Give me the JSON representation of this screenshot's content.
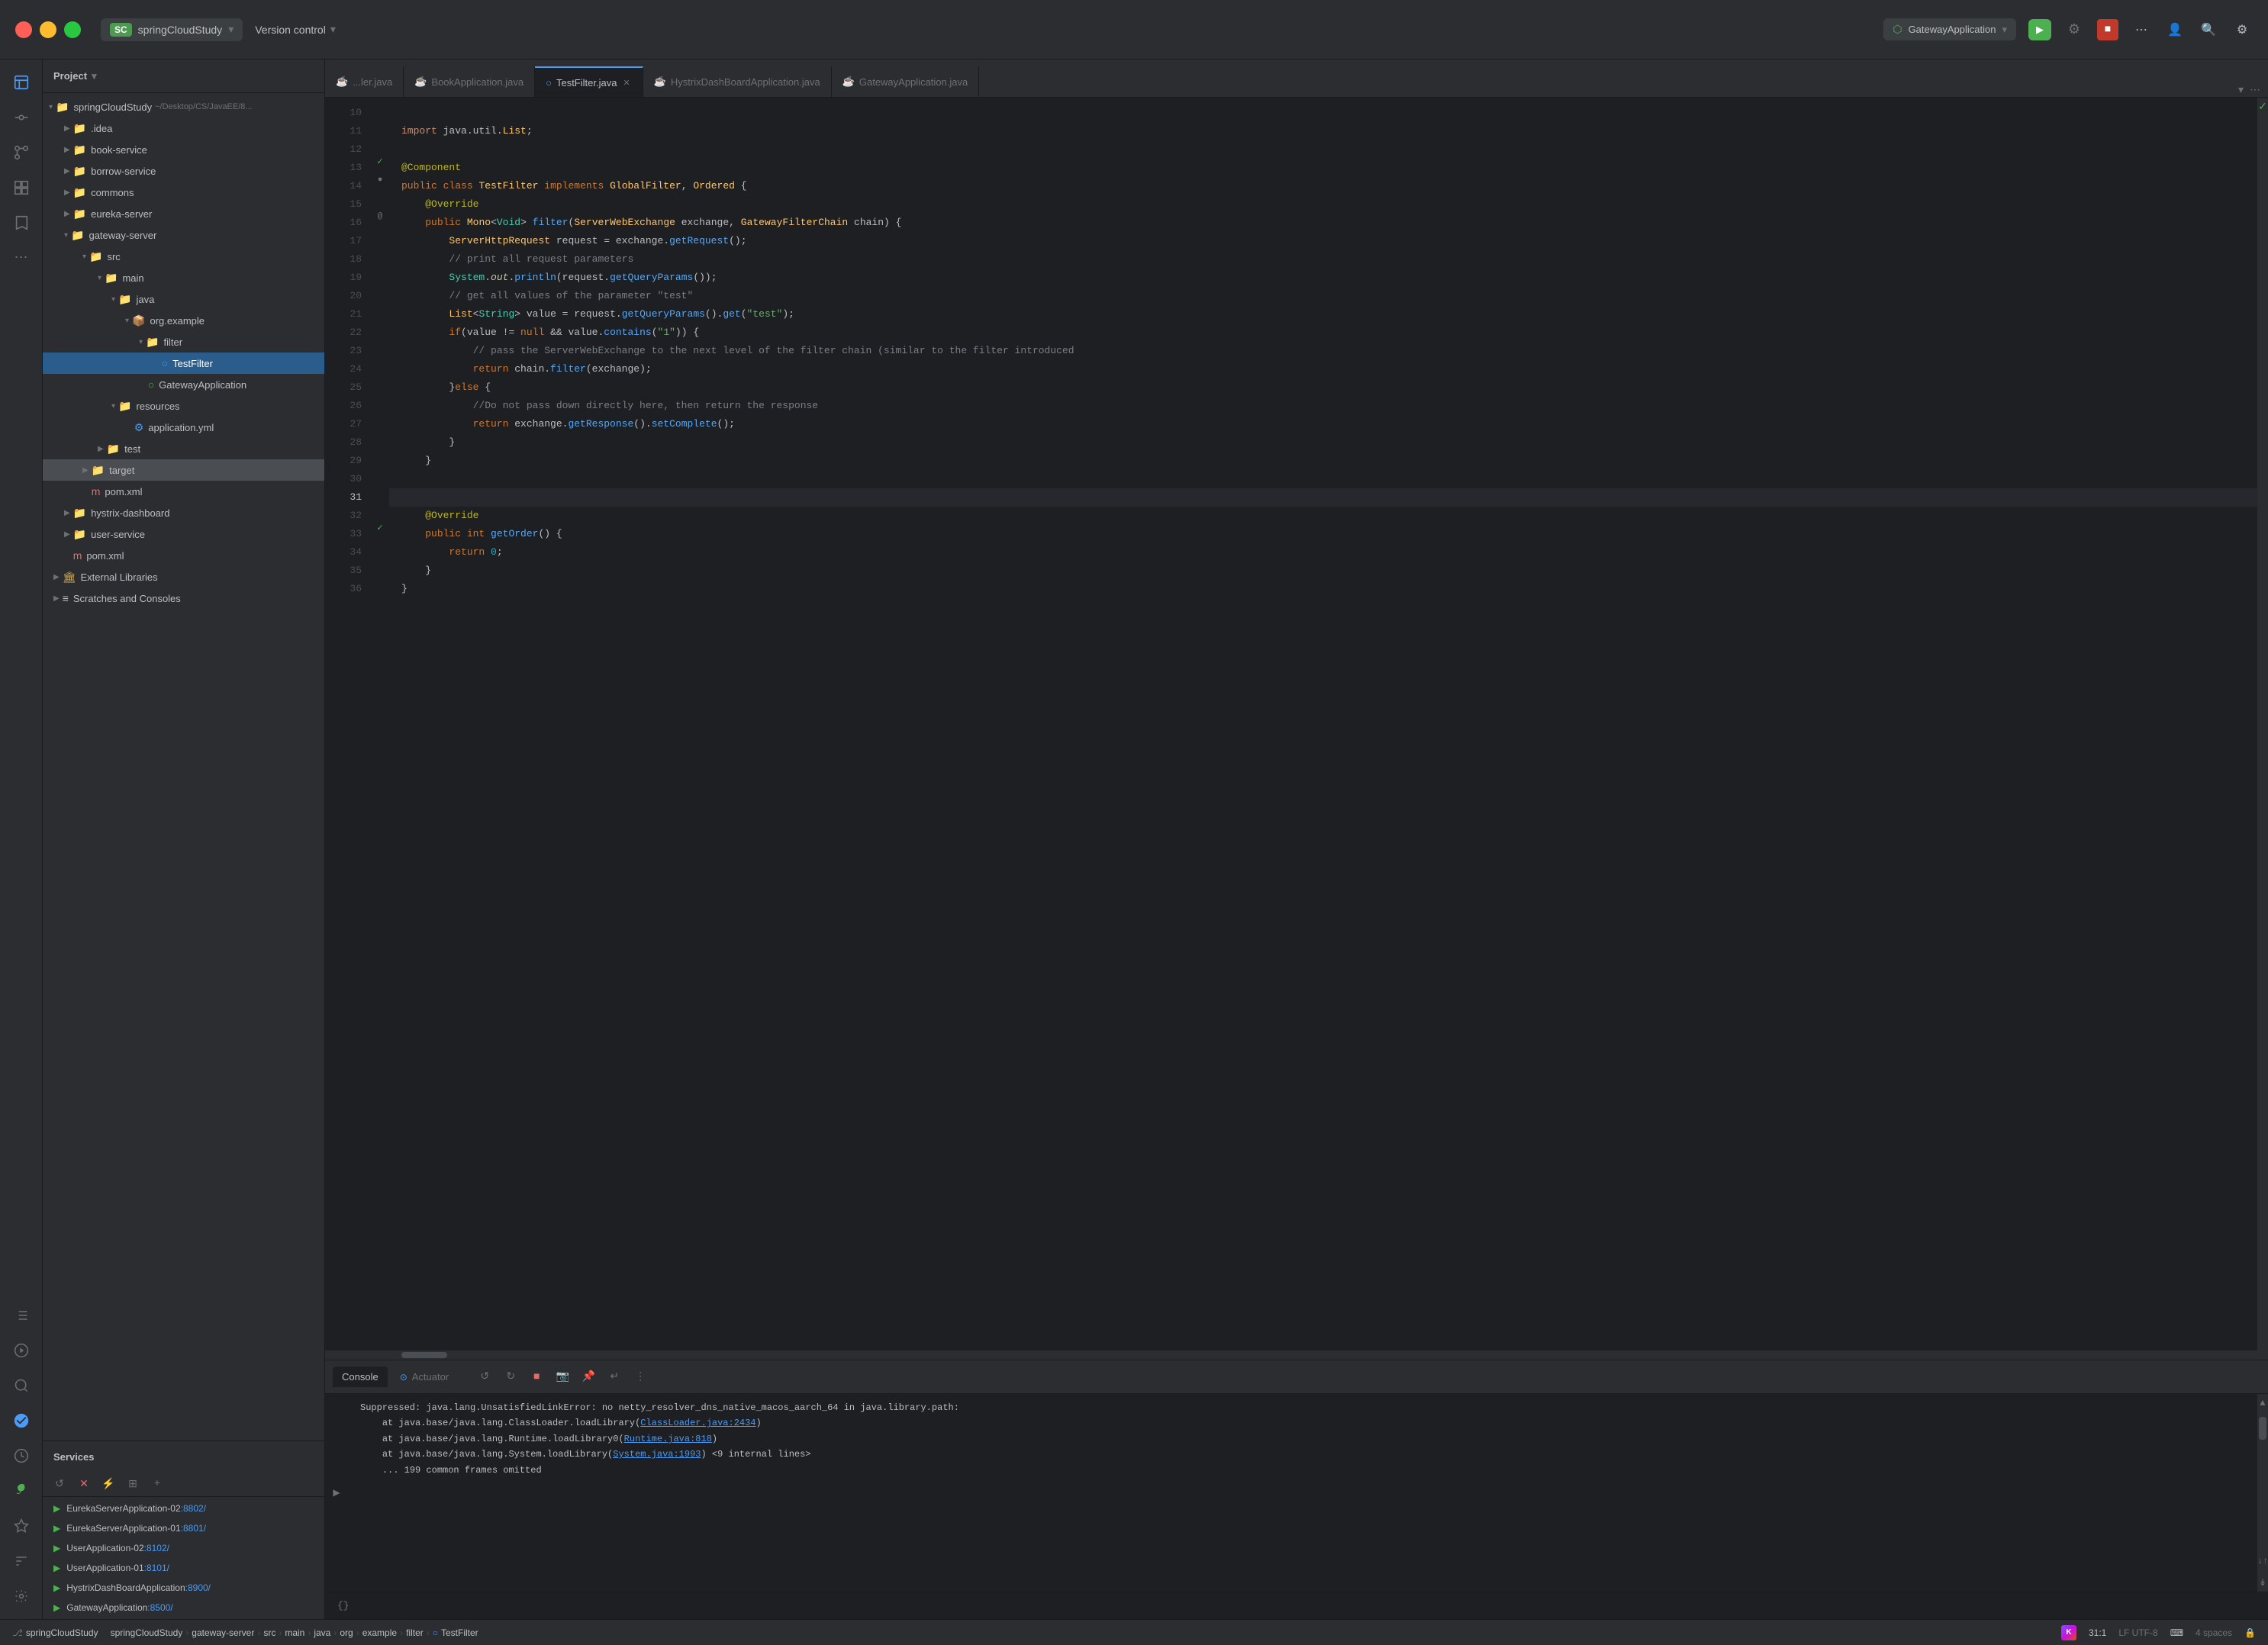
{
  "titlebar": {
    "project_name": "springCloudStudy",
    "sc_badge": "SC",
    "version_control_label": "Version control",
    "gateway_app": "GatewayApplication",
    "chevron": "▾"
  },
  "sidebar": {
    "icons": [
      "folder",
      "users",
      "git",
      "grid",
      "bookmark",
      "more"
    ],
    "bottom_icons": [
      "list",
      "circle",
      "magnify",
      "bot",
      "tool",
      "run"
    ]
  },
  "file_tree": {
    "panel_title": "Project",
    "root": "springCloudStudy",
    "root_path": "~/Desktop/CS/JavaEE/8...",
    "items": [
      {
        "level": 1,
        "type": "folder",
        "name": ".idea",
        "open": false
      },
      {
        "level": 1,
        "type": "folder",
        "name": "book-service",
        "open": false
      },
      {
        "level": 1,
        "type": "folder",
        "name": "borrow-service",
        "open": false
      },
      {
        "level": 1,
        "type": "folder",
        "name": "commons",
        "open": false
      },
      {
        "level": 1,
        "type": "folder",
        "name": "eureka-server",
        "open": false
      },
      {
        "level": 1,
        "type": "folder",
        "name": "gateway-server",
        "open": true
      },
      {
        "level": 2,
        "type": "folder",
        "name": "src",
        "open": true
      },
      {
        "level": 3,
        "type": "folder",
        "name": "main",
        "open": true
      },
      {
        "level": 4,
        "type": "folder",
        "name": "java",
        "open": true
      },
      {
        "level": 5,
        "type": "package",
        "name": "org.example",
        "open": true
      },
      {
        "level": 6,
        "type": "folder",
        "name": "filter",
        "open": true
      },
      {
        "level": 7,
        "type": "java",
        "name": "TestFilter",
        "selected": true
      },
      {
        "level": 6,
        "type": "java",
        "name": "GatewayApplication"
      },
      {
        "level": 4,
        "type": "folder",
        "name": "resources",
        "open": true
      },
      {
        "level": 5,
        "type": "yaml",
        "name": "application.yml"
      },
      {
        "level": 3,
        "type": "folder",
        "name": "test",
        "open": false
      },
      {
        "level": 2,
        "type": "folder",
        "name": "target",
        "open": false,
        "highlighted": true
      },
      {
        "level": 2,
        "type": "xml",
        "name": "pom.xml"
      },
      {
        "level": 1,
        "type": "folder",
        "name": "hystrix-dashboard",
        "open": false
      },
      {
        "level": 1,
        "type": "folder",
        "name": "user-service",
        "open": false
      },
      {
        "level": 1,
        "type": "xml",
        "name": "pom.xml"
      },
      {
        "level": 0,
        "type": "folder",
        "name": "External Libraries",
        "open": false
      },
      {
        "level": 0,
        "type": "folder",
        "name": "Scratches and Consoles",
        "open": false
      }
    ]
  },
  "services": {
    "panel_title": "Services",
    "items": [
      {
        "name": "EurekaServerApplication-02",
        "port": ":8802/",
        "running": true
      },
      {
        "name": "EurekaServerApplication-01",
        "port": ":8801/",
        "running": true
      },
      {
        "name": "UserApplication-02",
        "port": ":8102/",
        "running": true
      },
      {
        "name": "UserApplication-01",
        "port": ":8101/",
        "running": true
      },
      {
        "name": "HystrixDashBoardApplication",
        "port": ":8900/",
        "running": true
      },
      {
        "name": "GatewayApplication",
        "port": ":8500/",
        "running": true
      }
    ]
  },
  "tabs": [
    {
      "name": "...ler.java",
      "type": "java",
      "active": false
    },
    {
      "name": "BookApplication.java",
      "type": "java",
      "active": false
    },
    {
      "name": "TestFilter.java",
      "type": "filter",
      "active": true
    },
    {
      "name": "HystrixDashBoardApplication.java",
      "type": "java",
      "active": false
    },
    {
      "name": "GatewayApplication.java",
      "type": "java",
      "active": false
    }
  ],
  "code": {
    "filename": "TestFilter.java",
    "lines": [
      {
        "num": 10,
        "content": ""
      },
      {
        "num": 11,
        "content": "import java.util.List;"
      },
      {
        "num": 12,
        "content": ""
      },
      {
        "num": 13,
        "content": "@Component",
        "annotation": true
      },
      {
        "num": 14,
        "content": "public class TestFilter implements GlobalFilter, Ordered {"
      },
      {
        "num": 15,
        "content": "    @Override"
      },
      {
        "num": 16,
        "content": "    public Mono<Void> filter(ServerWebExchange exchange, GatewayFilterChain chain) {"
      },
      {
        "num": 17,
        "content": "        ServerHttpRequest request = exchange.getRequest();"
      },
      {
        "num": 18,
        "content": "        // print all request parameters"
      },
      {
        "num": 19,
        "content": "        System.out.println(request.getQueryParams());"
      },
      {
        "num": 20,
        "content": "        // get all values of the parameter \"test\""
      },
      {
        "num": 21,
        "content": "        List<String> value = request.getQueryParams().get(\"test\");"
      },
      {
        "num": 22,
        "content": "        if(value != null && value.contains(\"1\")) {"
      },
      {
        "num": 23,
        "content": "            // pass the ServerWebExchange to the next level of the filter chain (similar to the filter introduced"
      },
      {
        "num": 24,
        "content": "            return chain.filter(exchange);"
      },
      {
        "num": 25,
        "content": "        }else {"
      },
      {
        "num": 26,
        "content": "            //Do not pass down directly here, then return the response"
      },
      {
        "num": 27,
        "content": "            return exchange.getResponse().setComplete();"
      },
      {
        "num": 28,
        "content": "        }"
      },
      {
        "num": 29,
        "content": "    }"
      },
      {
        "num": 30,
        "content": ""
      },
      {
        "num": 31,
        "content": ""
      },
      {
        "num": 32,
        "content": "    @Override"
      },
      {
        "num": 33,
        "content": "    public int getOrder() {"
      },
      {
        "num": 34,
        "content": "        return 0;"
      },
      {
        "num": 35,
        "content": "    }"
      },
      {
        "num": 36,
        "content": "}"
      }
    ]
  },
  "console": {
    "tabs": [
      "Console",
      "Actuator"
    ],
    "output": [
      "Suppressed: java.lang.UnsatisfiedLinkError: no netty_resolver_dns_native_macos_aarch_64 in java.library.path:",
      "    at java.base/java.lang.ClassLoader.loadLibrary(ClassLoader.java:2434)",
      "    at java.base/java.lang.Runtime.loadLibrary0(Runtime.java:818)",
      "    at java.base/java.lang.System.loadLibrary(System.java:1993) <9 internal lines>",
      "    ... 199 common frames omitted"
    ]
  },
  "status_bar": {
    "branch": "springCloudStudy",
    "breadcrumbs": [
      "springCloudStudy",
      "gateway-server",
      "src",
      "main",
      "java",
      "org",
      "example",
      "filter",
      "TestFilter"
    ],
    "line_col": "31:1",
    "encoding": "LF  UTF-8",
    "spaces": "4 spaces"
  }
}
